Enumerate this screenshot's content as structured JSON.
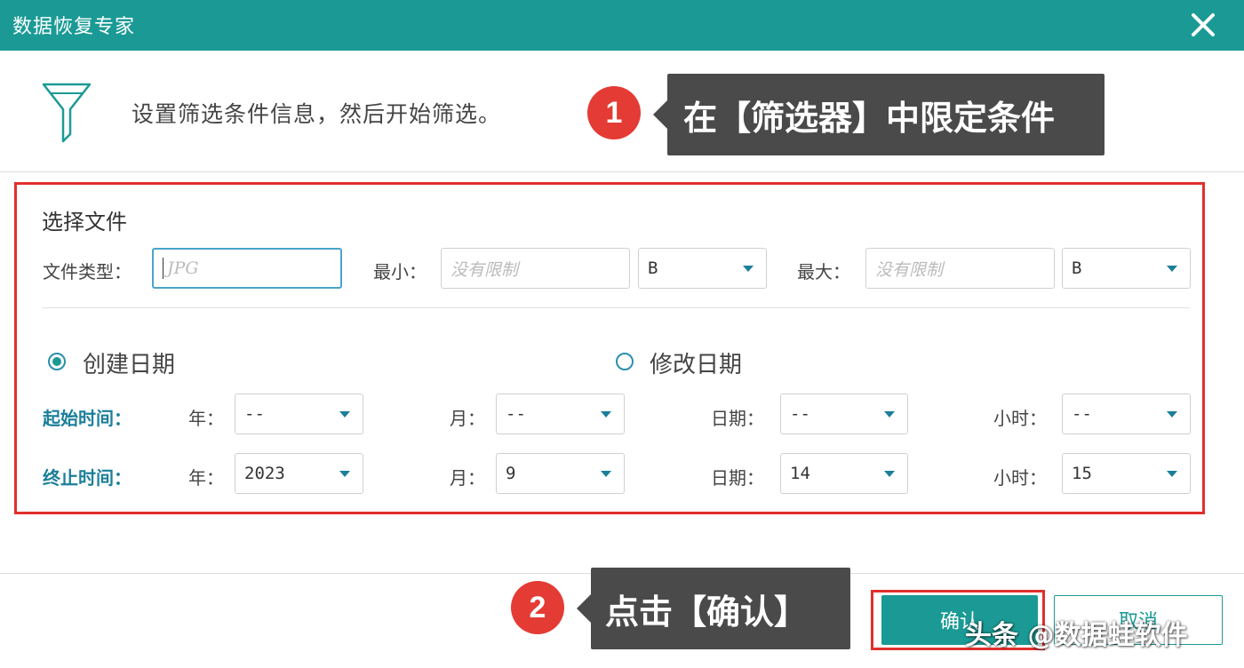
{
  "window": {
    "title": "数据恢复专家"
  },
  "header": {
    "description": "设置筛选条件信息，然后开始筛选。"
  },
  "annotations": {
    "step1": {
      "number": "1",
      "text": "在【筛选器】中限定条件"
    },
    "step2": {
      "number": "2",
      "text": "点击【确认】"
    }
  },
  "file_section": {
    "title": "选择文件",
    "file_type_label": "文件类型：",
    "file_type_placeholder": "JPG",
    "min_label": "最小：",
    "min_placeholder": "没有限制",
    "min_unit": "B",
    "max_label": "最大：",
    "max_placeholder": "没有限制",
    "max_unit": "B"
  },
  "date_section": {
    "created_label": "创建日期",
    "modified_label": "修改日期",
    "selected": "created",
    "start": {
      "label": "起始时间：",
      "year_label": "年：",
      "year": "--",
      "month_label": "月：",
      "month": "--",
      "day_label": "日期：",
      "day": "--",
      "hour_label": "小时：",
      "hour": "--"
    },
    "end": {
      "label": "终止时间：",
      "year_label": "年：",
      "year": "2023",
      "month_label": "月：",
      "month": "9",
      "day_label": "日期：",
      "day": "14",
      "hour_label": "小时：",
      "hour": "15"
    }
  },
  "footer": {
    "ok_label": "确认",
    "cancel_label": "取消"
  },
  "watermark": "头条 @数据蛙软件",
  "colors": {
    "title_bar": "#1b9a95",
    "highlight": "#e0302c",
    "callout_bg": "#4a4a4a"
  }
}
